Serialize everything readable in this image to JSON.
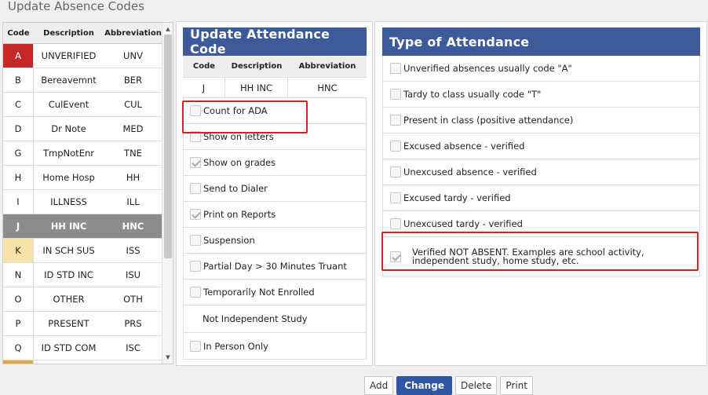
{
  "page": {
    "title": "Update Absence Codes"
  },
  "codes_table": {
    "headers": {
      "code": "Code",
      "description": "Description",
      "abbreviation": "Abbreviation"
    },
    "rows": [
      {
        "code": "A",
        "description": "UNVERIFIED",
        "abbreviation": "UNV",
        "state": "red"
      },
      {
        "code": "B",
        "description": "Bereavemnt",
        "abbreviation": "BER",
        "state": ""
      },
      {
        "code": "C",
        "description": "CulEvent",
        "abbreviation": "CUL",
        "state": ""
      },
      {
        "code": "D",
        "description": "Dr Note",
        "abbreviation": "MED",
        "state": ""
      },
      {
        "code": "G",
        "description": "TmpNotEnr",
        "abbreviation": "TNE",
        "state": ""
      },
      {
        "code": "H",
        "description": "Home Hosp",
        "abbreviation": "HH",
        "state": ""
      },
      {
        "code": "I",
        "description": "ILLNESS",
        "abbreviation": "ILL",
        "state": ""
      },
      {
        "code": "J",
        "description": "HH INC",
        "abbreviation": "HNC",
        "state": "selected"
      },
      {
        "code": "K",
        "description": "IN SCH SUS",
        "abbreviation": "ISS",
        "state": "yellow"
      },
      {
        "code": "N",
        "description": "ID STD INC",
        "abbreviation": "ISU",
        "state": ""
      },
      {
        "code": "O",
        "description": "OTHER",
        "abbreviation": "OTH",
        "state": ""
      },
      {
        "code": "P",
        "description": "PRESENT",
        "abbreviation": "PRS",
        "state": ""
      },
      {
        "code": "Q",
        "description": "ID STD COM",
        "abbreviation": "ISC",
        "state": ""
      }
    ]
  },
  "update_panel": {
    "title": "Update Attendance Code",
    "headers": {
      "code": "Code",
      "description": "Description",
      "abbreviation": "Abbreviation"
    },
    "record": {
      "code": "J",
      "description": "HH INC",
      "abbreviation": "HNC"
    },
    "options": [
      {
        "label": "Count for ADA",
        "checked": false
      },
      {
        "label": "Show on letters",
        "checked": false
      },
      {
        "label": "Show on grades",
        "checked": true
      },
      {
        "label": "Send to Dialer",
        "checked": false
      },
      {
        "label": "Print on Reports",
        "checked": true
      },
      {
        "label": "Suspension",
        "checked": false
      },
      {
        "label": "Partial Day > 30 Minutes Truant",
        "checked": false
      },
      {
        "label": "Temporarily Not Enrolled",
        "checked": false
      }
    ],
    "plain_option": "Not Independent Study",
    "last_option": {
      "label": "In Person Only",
      "checked": false
    }
  },
  "type_panel": {
    "title": "Type of Attendance",
    "options": [
      {
        "label": "Unverified absences usually code \"A\"",
        "checked": false
      },
      {
        "label": "Tardy to class usually code \"T\"",
        "checked": false
      },
      {
        "label": "Present in class (positive attendance)",
        "checked": false
      },
      {
        "label": "Excused absence - verified",
        "checked": false
      },
      {
        "label": "Unexcused absence - verified",
        "checked": false
      },
      {
        "label": "Excused tardy - verified",
        "checked": false
      },
      {
        "label": "Unexcused tardy - verified",
        "checked": false
      }
    ],
    "verified_option": {
      "label": "Verified NOT ABSENT. Examples are school activity, independent study, home study, etc.",
      "checked": true
    }
  },
  "buttons": {
    "add": "Add",
    "change": "Change",
    "delete": "Delete",
    "print": "Print"
  }
}
